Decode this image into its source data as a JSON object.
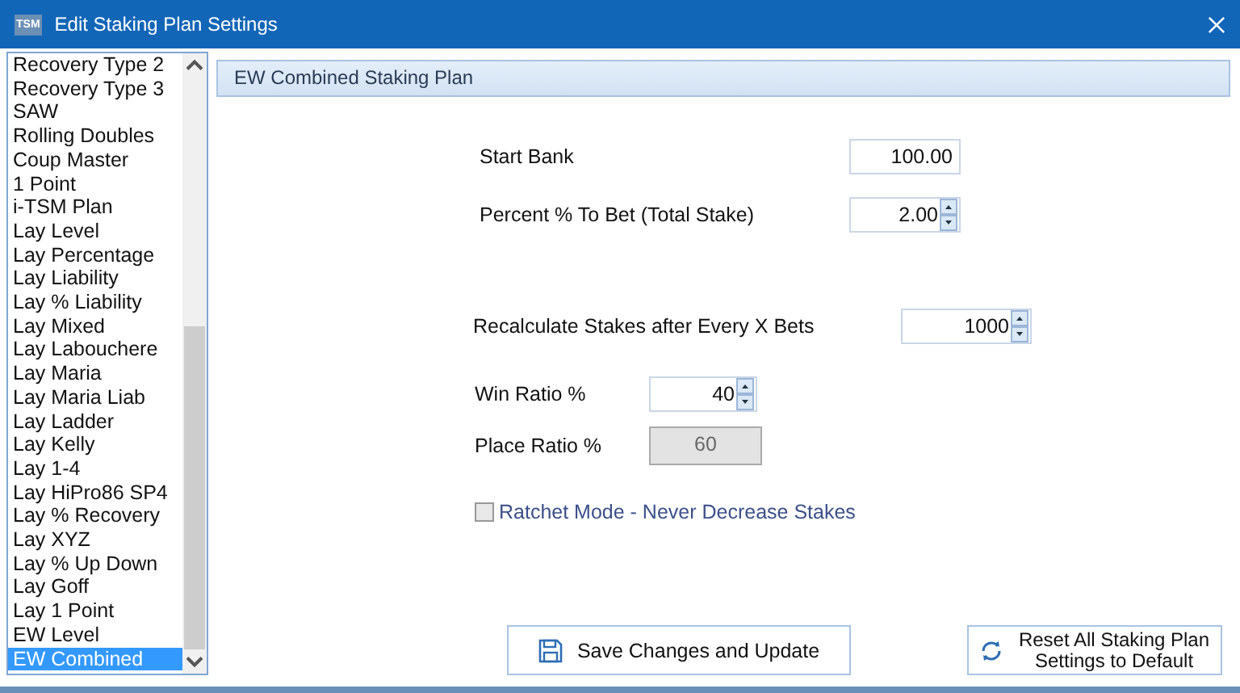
{
  "window": {
    "title": "Edit Staking Plan Settings",
    "icon_text": "TSM"
  },
  "plan_list": {
    "items": [
      {
        "label": "Recovery Type 2",
        "selected": false
      },
      {
        "label": "Recovery Type 3",
        "selected": false
      },
      {
        "label": "SAW",
        "selected": false
      },
      {
        "label": "Rolling Doubles",
        "selected": false
      },
      {
        "label": "Coup Master",
        "selected": false
      },
      {
        "label": "1 Point",
        "selected": false
      },
      {
        "label": "i-TSM Plan",
        "selected": false
      },
      {
        "label": "Lay Level",
        "selected": false
      },
      {
        "label": "Lay Percentage",
        "selected": false
      },
      {
        "label": "Lay Liability",
        "selected": false
      },
      {
        "label": "Lay % Liability",
        "selected": false
      },
      {
        "label": "Lay Mixed",
        "selected": false
      },
      {
        "label": "Lay Labouchere",
        "selected": false
      },
      {
        "label": "Lay Maria",
        "selected": false
      },
      {
        "label": "Lay Maria Liab",
        "selected": false
      },
      {
        "label": "Lay Ladder",
        "selected": false
      },
      {
        "label": "Lay Kelly",
        "selected": false
      },
      {
        "label": "Lay 1-4",
        "selected": false
      },
      {
        "label": "Lay HiPro86 SP4",
        "selected": false
      },
      {
        "label": "Lay % Recovery",
        "selected": false
      },
      {
        "label": "Lay XYZ",
        "selected": false
      },
      {
        "label": "Lay % Up Down",
        "selected": false
      },
      {
        "label": "Lay Goff",
        "selected": false
      },
      {
        "label": "Lay 1 Point",
        "selected": false
      },
      {
        "label": "EW Level",
        "selected": false
      },
      {
        "label": "EW Combined",
        "selected": true
      }
    ]
  },
  "panel": {
    "header": "EW Combined Staking Plan",
    "bank_fields": [
      {
        "kind": "text",
        "label": "Start Bank",
        "value": "100.00"
      },
      {
        "kind": "spinner",
        "label": "Percent % To Bet (Total Stake)",
        "value": "2.00"
      }
    ],
    "recalc_field": {
      "kind": "spinner",
      "label": "Recalculate Stakes after Every X Bets",
      "value": "1000"
    },
    "ratio_fields": [
      {
        "kind": "spinner",
        "label": "Win Ratio %",
        "value": "40"
      },
      {
        "kind": "disabled",
        "label": "Place Ratio %",
        "value": "60"
      }
    ],
    "ratchet": {
      "label": "Ratchet Mode - Never Decrease Stakes",
      "checked": false
    },
    "buttons": [
      {
        "kind": "save",
        "label": "Save Changes and Update"
      },
      {
        "kind": "reset",
        "label": "Reset All Staking Plan Settings to Default"
      }
    ]
  }
}
